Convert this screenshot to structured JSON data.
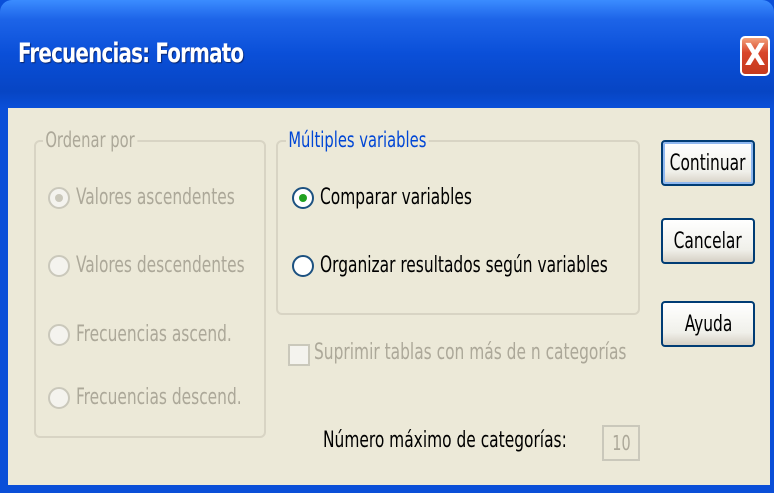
{
  "window": {
    "title": "Frecuencias: Formato",
    "close_label": "X"
  },
  "sort_group": {
    "label": "Ordenar por",
    "options": [
      {
        "label": "Valores ascendentes",
        "selected": true,
        "enabled": false
      },
      {
        "label": "Valores descendentes",
        "selected": false,
        "enabled": false
      },
      {
        "label": "Frecuencias ascend.",
        "selected": false,
        "enabled": false
      },
      {
        "label": "Frecuencias descend.",
        "selected": false,
        "enabled": false
      }
    ]
  },
  "multi_group": {
    "label": "Múltiples variables",
    "options": [
      {
        "label": "Comparar variables",
        "selected": true,
        "enabled": true
      },
      {
        "label": "Organizar resultados según variables",
        "selected": false,
        "enabled": true
      }
    ]
  },
  "suppress": {
    "label": "Suprimir tablas con más de n categorías",
    "checked": false,
    "enabled": false
  },
  "max_categories": {
    "label": "Número máximo de categorías:",
    "value": "10"
  },
  "buttons": {
    "continue": "Continuar",
    "cancel": "Cancelar",
    "help": "Ayuda"
  },
  "colors": {
    "titlebar": "#0a4fd8",
    "dialog_bg": "#ece9d8",
    "radio_selected": "#21a121",
    "disabled_text": "#aca899"
  }
}
